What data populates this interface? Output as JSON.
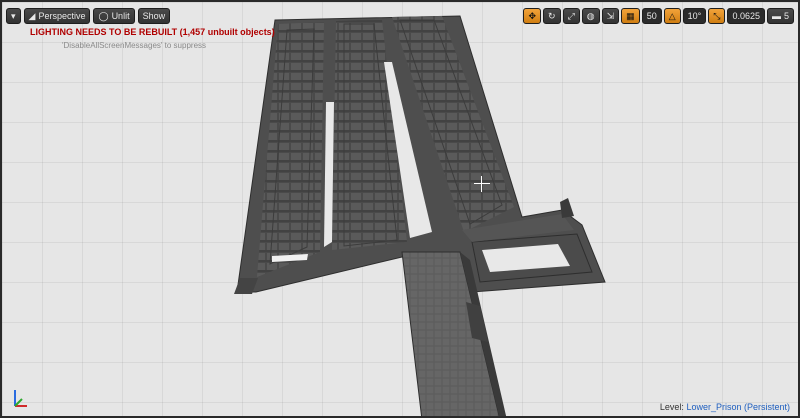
{
  "toolbar": {
    "menu_icon": "chevron-down-icon",
    "perspective_label": "Perspective",
    "unlit_label": "Unlit",
    "show_label": "Show",
    "grid_snap_value": "50",
    "rotation_snap_value": "10°",
    "scale_snap_value": "0.0625",
    "camera_speed_value": "5"
  },
  "messages": {
    "lighting_warning": "LIGHTING NEEDS TO BE REBUILT (1,457 unbuilt objects)",
    "suppress_hint": "'DisableAllScreenMessages' to suppress"
  },
  "status": {
    "level_label": "Level:",
    "level_name": "Lower_Prison (Persistent)"
  },
  "colors": {
    "accent": "#e8951f",
    "warning": "#b00000",
    "level_link": "#1f5fbf",
    "mesh": "#555555"
  }
}
